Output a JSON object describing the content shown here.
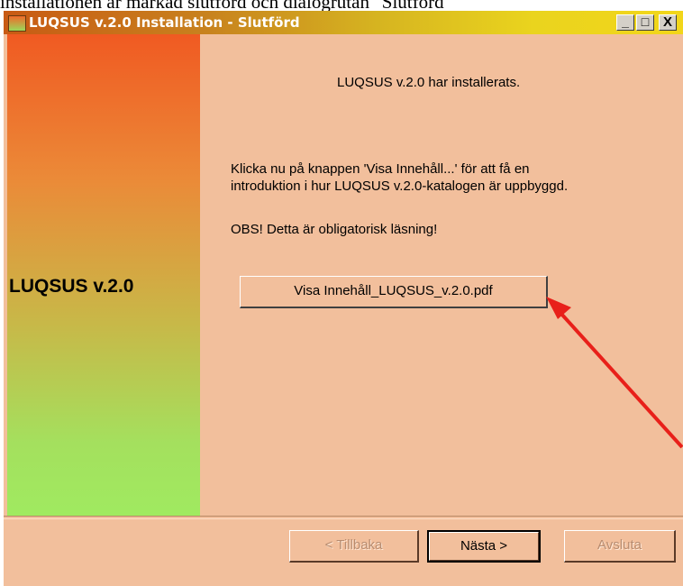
{
  "doc_fragment": "installationen är markad slutförd och dialogrutan \"Slutförd\"",
  "window": {
    "title": "LUQSUS v.2.0 Installation - Slutförd",
    "minimize_glyph": "_",
    "maximize_glyph": "□",
    "close_glyph": "X"
  },
  "sidebar": {
    "title": "LUQSUS v.2.0"
  },
  "content": {
    "success_message": "LUQSUS v.2.0 har installerats.",
    "intro_line1": "Klicka nu på knappen 'Visa Innehåll...' för att få en",
    "intro_line2": "introduktion i hur LUQSUS v.2.0-katalogen är uppbyggd.",
    "obs_note": "OBS! Detta är obligatorisk läsning!",
    "pdf_button_label": "Visa Innehåll_LUQSUS_v.2.0.pdf"
  },
  "footer": {
    "back_label": "< Tillbaka",
    "next_label": "Nästa >",
    "exit_label": "Avsluta"
  },
  "annotation": {
    "arrow_color": "#e8201a"
  }
}
